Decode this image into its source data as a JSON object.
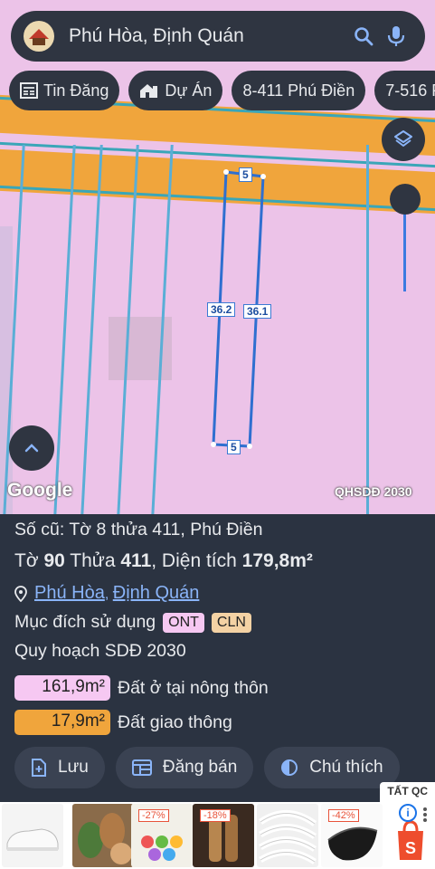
{
  "search": {
    "text": "Phú Hòa, Định Quán"
  },
  "chips": [
    {
      "label": "Tin Đăng",
      "icon": "newspaper-icon"
    },
    {
      "label": "Dự Án",
      "icon": "house-icon"
    },
    {
      "label": "8-411 Phú Điền"
    },
    {
      "label": "7-516 P"
    }
  ],
  "map": {
    "labels": {
      "top": "5",
      "bottom": "5",
      "left": "36.2",
      "right": "36.1"
    },
    "google": "Google",
    "layer": "QHSDĐ 2030"
  },
  "info": {
    "old": "Số cũ: Tờ 8 thửa 411, Phú Điền",
    "to_label": "Tờ",
    "to_value": "90",
    "thua_label": "Thửa",
    "thua_value": "411",
    "dt_label": ", Diện tích",
    "dt_value": "179,8m²",
    "loc_part1": "Phú Hòa",
    "loc_sep": ",",
    "loc_part2": "Định Quán",
    "purpose_label": "Mục đích sử dụng",
    "tag1": "ONT",
    "tag2": "CLN",
    "plan_label": "Quy hoạch SDĐ 2030",
    "area1_value": "161,9m²",
    "area1_label": "Đất ở tại nông thôn",
    "area2_value": "17,9m²",
    "area2_label": "Đất giao thông"
  },
  "actions": {
    "save": "Lưu",
    "sell": "Đăng bán",
    "legend": "Chú thích"
  },
  "ads": {
    "close": "TẤT QC",
    "info": "i",
    "discounts": [
      "-27%",
      "-18%",
      "-42%"
    ]
  },
  "colors": {
    "accent": "#8ab4f8",
    "road": "#f0a53c",
    "land": "#ecc3e8",
    "tag_ont": "#f6c8f2",
    "tag_cln": "#f4d2a4",
    "area1": "#f6c8f2",
    "area2": "#f0a53c"
  }
}
